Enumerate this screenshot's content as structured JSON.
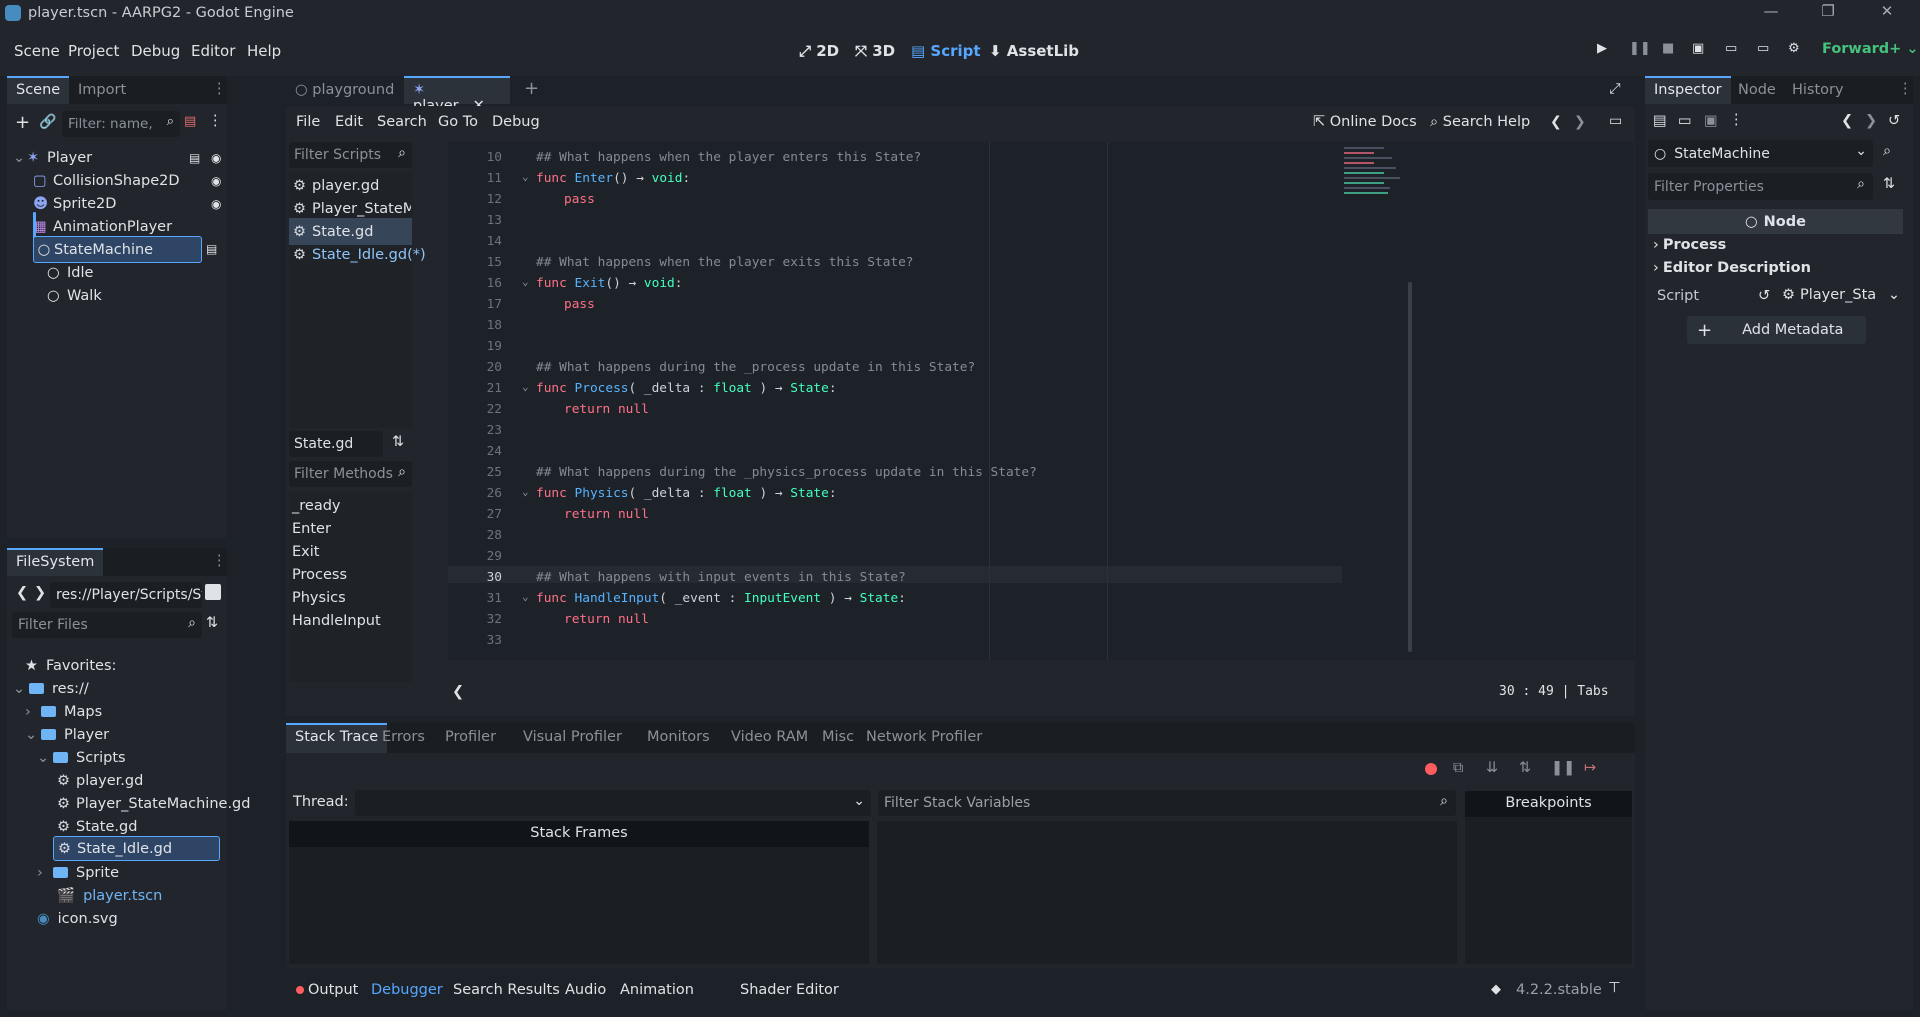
{
  "window": {
    "title": "player.tscn - AARPG2 - Godot Engine"
  },
  "menu": [
    "Scene",
    "Project",
    "Debug",
    "Editor",
    "Help"
  ],
  "workspaces": [
    "2D",
    "3D",
    "Script",
    "AssetLib"
  ],
  "renderer": "Forward+",
  "scene_dock": {
    "tabs": [
      "Scene",
      "Import"
    ],
    "filter_placeholder": "Filter: name, t:t",
    "nodes": [
      "Player",
      "CollisionShape2D",
      "Sprite2D",
      "AnimationPlayer",
      "StateMachine",
      "Idle",
      "Walk"
    ]
  },
  "filesystem": {
    "tab": "FileSystem",
    "path": "res://Player/Scripts/State_I",
    "filter_placeholder": "Filter Files",
    "items": [
      "Favorites:",
      "res://",
      "Maps",
      "Player",
      "Scripts",
      "player.gd",
      "Player_StateMachine.gd",
      "State.gd",
      "State_Idle.gd",
      "Sprite",
      "player.tscn",
      "icon.svg"
    ]
  },
  "editor_tabs": [
    "playground",
    "player"
  ],
  "script_menu": [
    "File",
    "Edit",
    "Search",
    "Go To",
    "Debug"
  ],
  "online_docs": "Online Docs",
  "search_help": "Search Help",
  "scripts": {
    "filter_placeholder": "Filter Scripts",
    "items": [
      "player.gd",
      "Player_StateMa...",
      "State.gd",
      "State_Idle.gd(*)"
    ],
    "current": "State.gd"
  },
  "methods": {
    "filter_placeholder": "Filter Methods",
    "items": [
      "_ready",
      "Enter",
      "Exit",
      "Process",
      "Physics",
      "HandleInput"
    ]
  },
  "code_lines": [
    {
      "n": "10",
      "t": "## What happens when the player enters this State?"
    },
    {
      "n": "11",
      "t": "func Enter() → void:"
    },
    {
      "n": "12",
      "t": "pass"
    },
    {
      "n": "13",
      "t": ""
    },
    {
      "n": "14",
      "t": ""
    },
    {
      "n": "15",
      "t": "## What happens when the player exits this State?"
    },
    {
      "n": "16",
      "t": "func Exit() → void:"
    },
    {
      "n": "17",
      "t": "pass"
    },
    {
      "n": "18",
      "t": ""
    },
    {
      "n": "19",
      "t": ""
    },
    {
      "n": "20",
      "t": "## What happens during the _process update in this State?"
    },
    {
      "n": "21",
      "t": "func Process( _delta : float ) → State:"
    },
    {
      "n": "22",
      "t": "return null"
    },
    {
      "n": "23",
      "t": ""
    },
    {
      "n": "24",
      "t": ""
    },
    {
      "n": "25",
      "t": "## What happens during the _physics_process update in this State?"
    },
    {
      "n": "26",
      "t": "func Physics( _delta : float ) → State:"
    },
    {
      "n": "27",
      "t": "return null"
    },
    {
      "n": "28",
      "t": ""
    },
    {
      "n": "29",
      "t": ""
    },
    {
      "n": "30",
      "t": "## What happens with input events in this State?"
    },
    {
      "n": "31",
      "t": "func HandleInput( _event : InputEvent ) → State:"
    },
    {
      "n": "32",
      "t": "return null"
    },
    {
      "n": "33",
      "t": ""
    }
  ],
  "status": {
    "line": "30",
    "col": "49",
    "indent": "Tabs"
  },
  "debugger": {
    "tabs": [
      "Stack Trace",
      "Errors",
      "Profiler",
      "Visual Profiler",
      "Monitors",
      "Video RAM",
      "Misc",
      "Network Profiler"
    ],
    "thread_label": "Thread:",
    "filter_vars_placeholder": "Filter Stack Variables",
    "stack_frames": "Stack Frames",
    "breakpoints": "Breakpoints"
  },
  "bottom_tabs": [
    "Output",
    "Debugger",
    "Search Results",
    "Audio",
    "Animation",
    "Shader Editor"
  ],
  "version": "4.2.2.stable",
  "inspector": {
    "tabs": [
      "Inspector",
      "Node",
      "History"
    ],
    "object": "StateMachine",
    "filter_placeholder": "Filter Properties",
    "node": "Node",
    "process": "Process",
    "editor_description": "Editor Description",
    "script_label": "Script",
    "script_value": "Player_Sta",
    "add_metadata": "Add Metadata"
  },
  "colors": {
    "accent": "#57a7ff",
    "background": "#1d2229",
    "panel": "#22262c"
  }
}
